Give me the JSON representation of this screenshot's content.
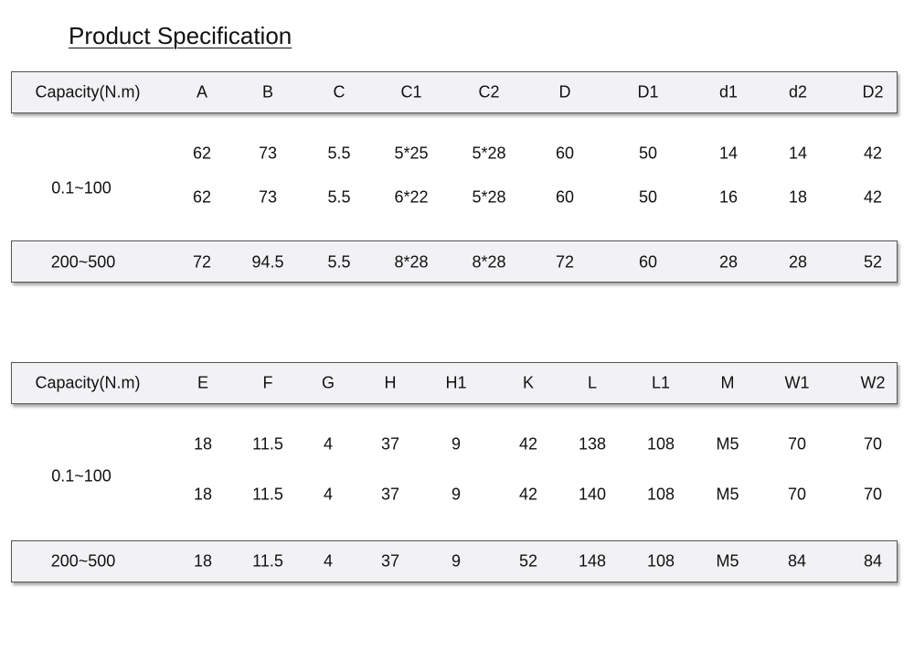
{
  "title": "Product Specification",
  "tables": [
    {
      "headers": [
        "Capacity(N.m)",
        "A",
        "B",
        "C",
        "C1",
        "C2",
        "D",
        "D1",
        "d1",
        "d2",
        "D2"
      ],
      "groups": [
        {
          "label": "0.1~100",
          "rows": [
            [
              "62",
              "73",
              "5.5",
              "5*25",
              "5*28",
              "60",
              "50",
              "14",
              "14",
              "42"
            ],
            [
              "62",
              "73",
              "5.5",
              "6*22",
              "5*28",
              "60",
              "50",
              "16",
              "18",
              "42"
            ]
          ]
        },
        {
          "label": "200~500",
          "rows": [
            [
              "72",
              "94.5",
              "5.5",
              "8*28",
              "8*28",
              "72",
              "60",
              "28",
              "28",
              "52"
            ]
          ]
        }
      ]
    },
    {
      "headers": [
        "Capacity(N.m)",
        "E",
        "F",
        "G",
        "H",
        "H1",
        "K",
        "L",
        "L1",
        "M",
        "W1",
        "W2"
      ],
      "groups": [
        {
          "label": "0.1~100",
          "rows": [
            [
              "18",
              "11.5",
              "4",
              "37",
              "9",
              "42",
              "138",
              "108",
              "M5",
              "70",
              "70"
            ],
            [
              "18",
              "11.5",
              "4",
              "37",
              "9",
              "42",
              "140",
              "108",
              "M5",
              "70",
              "70"
            ]
          ]
        },
        {
          "label": "200~500",
          "rows": [
            [
              "18",
              "11.5",
              "4",
              "37",
              "9",
              "52",
              "148",
              "108",
              "M5",
              "84",
              "84"
            ]
          ]
        }
      ]
    }
  ]
}
